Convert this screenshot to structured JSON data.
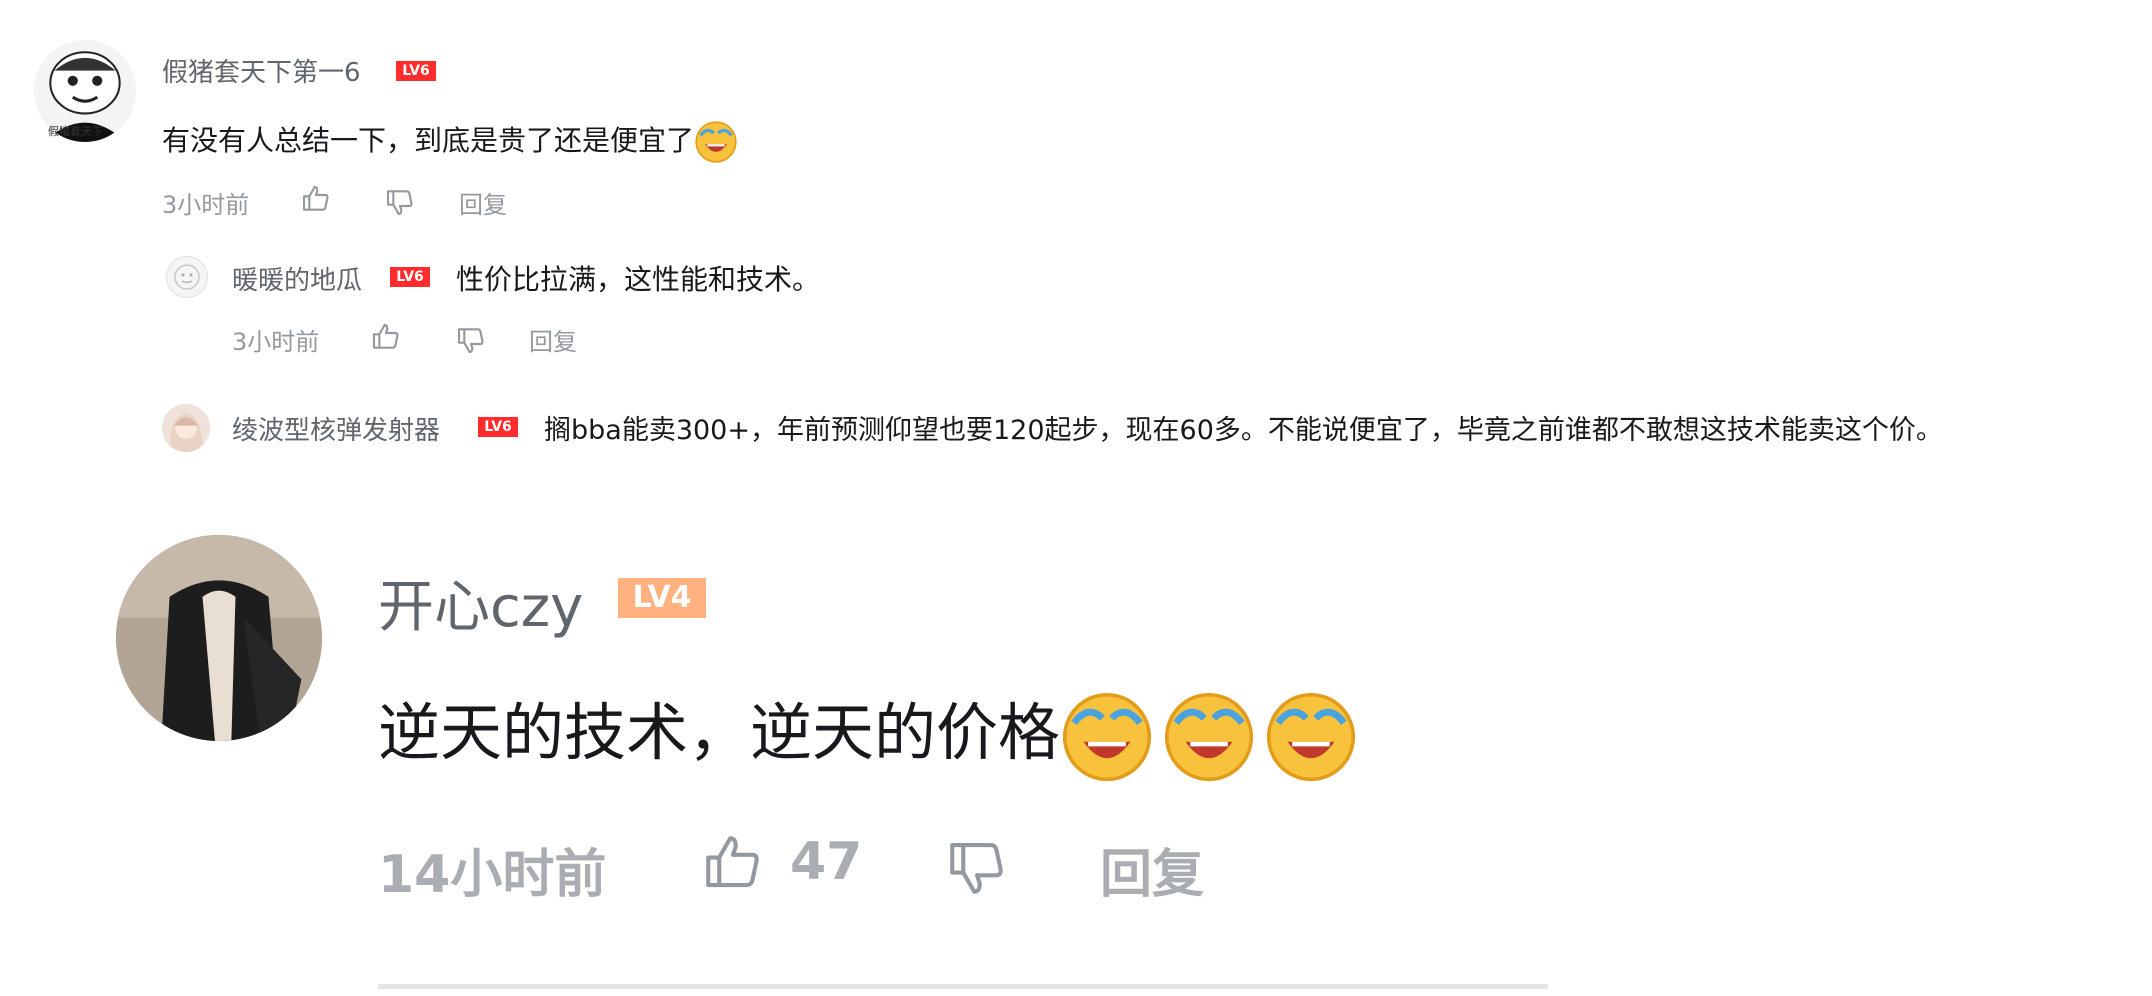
{
  "comments": [
    {
      "username": "假猪套天下第一6",
      "level": "LV6",
      "avatar_caption": "假猪套天下",
      "text": "有没有人总结一下，到底是贵了还是便宜了",
      "emoji_name": "laugh-cry-emoji",
      "time": "3小时前",
      "reply_label": "回复"
    },
    {
      "username": "暖暖的地瓜",
      "level": "LV6",
      "text": "性价比拉满，这性能和技术。",
      "time": "3小时前",
      "reply_label": "回复"
    },
    {
      "username": "绫波型核弹发射器",
      "level": "LV6",
      "text": "搁bba能卖300+，年前预测仰望也要120起步，现在60多。不能说便宜了，毕竟之前谁都不敢想这技术能卖这个价。"
    },
    {
      "username": "开心czy",
      "level": "LV4",
      "text": "逆天的技术，逆天的价格",
      "emoji_name": "laugh-cry-emoji",
      "emoji_count": 3,
      "time": "14小时前",
      "like_count": "47",
      "reply_label": "回复"
    }
  ],
  "colors": {
    "lv6_badge": "#fe2c2c",
    "lv4_badge": "#ffb27f",
    "meta_text": "#9499a0",
    "username_text": "#61666d"
  }
}
